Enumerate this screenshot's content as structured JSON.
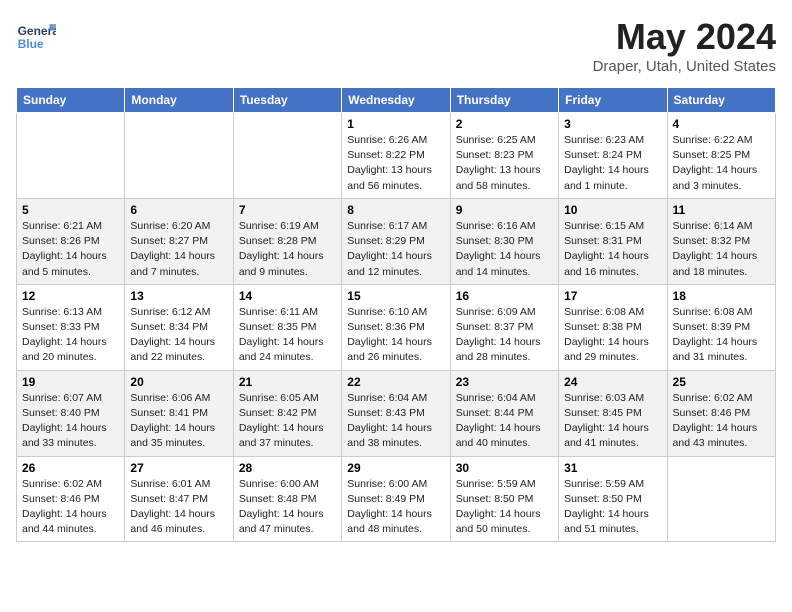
{
  "header": {
    "logo_line1": "General",
    "logo_line2": "Blue",
    "month": "May 2024",
    "location": "Draper, Utah, United States"
  },
  "days_of_week": [
    "Sunday",
    "Monday",
    "Tuesday",
    "Wednesday",
    "Thursday",
    "Friday",
    "Saturday"
  ],
  "weeks": [
    [
      {
        "day": "",
        "sunrise": "",
        "sunset": "",
        "daylight": ""
      },
      {
        "day": "",
        "sunrise": "",
        "sunset": "",
        "daylight": ""
      },
      {
        "day": "",
        "sunrise": "",
        "sunset": "",
        "daylight": ""
      },
      {
        "day": "1",
        "sunrise": "Sunrise: 6:26 AM",
        "sunset": "Sunset: 8:22 PM",
        "daylight": "Daylight: 13 hours and 56 minutes."
      },
      {
        "day": "2",
        "sunrise": "Sunrise: 6:25 AM",
        "sunset": "Sunset: 8:23 PM",
        "daylight": "Daylight: 13 hours and 58 minutes."
      },
      {
        "day": "3",
        "sunrise": "Sunrise: 6:23 AM",
        "sunset": "Sunset: 8:24 PM",
        "daylight": "Daylight: 14 hours and 1 minute."
      },
      {
        "day": "4",
        "sunrise": "Sunrise: 6:22 AM",
        "sunset": "Sunset: 8:25 PM",
        "daylight": "Daylight: 14 hours and 3 minutes."
      }
    ],
    [
      {
        "day": "5",
        "sunrise": "Sunrise: 6:21 AM",
        "sunset": "Sunset: 8:26 PM",
        "daylight": "Daylight: 14 hours and 5 minutes."
      },
      {
        "day": "6",
        "sunrise": "Sunrise: 6:20 AM",
        "sunset": "Sunset: 8:27 PM",
        "daylight": "Daylight: 14 hours and 7 minutes."
      },
      {
        "day": "7",
        "sunrise": "Sunrise: 6:19 AM",
        "sunset": "Sunset: 8:28 PM",
        "daylight": "Daylight: 14 hours and 9 minutes."
      },
      {
        "day": "8",
        "sunrise": "Sunrise: 6:17 AM",
        "sunset": "Sunset: 8:29 PM",
        "daylight": "Daylight: 14 hours and 12 minutes."
      },
      {
        "day": "9",
        "sunrise": "Sunrise: 6:16 AM",
        "sunset": "Sunset: 8:30 PM",
        "daylight": "Daylight: 14 hours and 14 minutes."
      },
      {
        "day": "10",
        "sunrise": "Sunrise: 6:15 AM",
        "sunset": "Sunset: 8:31 PM",
        "daylight": "Daylight: 14 hours and 16 minutes."
      },
      {
        "day": "11",
        "sunrise": "Sunrise: 6:14 AM",
        "sunset": "Sunset: 8:32 PM",
        "daylight": "Daylight: 14 hours and 18 minutes."
      }
    ],
    [
      {
        "day": "12",
        "sunrise": "Sunrise: 6:13 AM",
        "sunset": "Sunset: 8:33 PM",
        "daylight": "Daylight: 14 hours and 20 minutes."
      },
      {
        "day": "13",
        "sunrise": "Sunrise: 6:12 AM",
        "sunset": "Sunset: 8:34 PM",
        "daylight": "Daylight: 14 hours and 22 minutes."
      },
      {
        "day": "14",
        "sunrise": "Sunrise: 6:11 AM",
        "sunset": "Sunset: 8:35 PM",
        "daylight": "Daylight: 14 hours and 24 minutes."
      },
      {
        "day": "15",
        "sunrise": "Sunrise: 6:10 AM",
        "sunset": "Sunset: 8:36 PM",
        "daylight": "Daylight: 14 hours and 26 minutes."
      },
      {
        "day": "16",
        "sunrise": "Sunrise: 6:09 AM",
        "sunset": "Sunset: 8:37 PM",
        "daylight": "Daylight: 14 hours and 28 minutes."
      },
      {
        "day": "17",
        "sunrise": "Sunrise: 6:08 AM",
        "sunset": "Sunset: 8:38 PM",
        "daylight": "Daylight: 14 hours and 29 minutes."
      },
      {
        "day": "18",
        "sunrise": "Sunrise: 6:08 AM",
        "sunset": "Sunset: 8:39 PM",
        "daylight": "Daylight: 14 hours and 31 minutes."
      }
    ],
    [
      {
        "day": "19",
        "sunrise": "Sunrise: 6:07 AM",
        "sunset": "Sunset: 8:40 PM",
        "daylight": "Daylight: 14 hours and 33 minutes."
      },
      {
        "day": "20",
        "sunrise": "Sunrise: 6:06 AM",
        "sunset": "Sunset: 8:41 PM",
        "daylight": "Daylight: 14 hours and 35 minutes."
      },
      {
        "day": "21",
        "sunrise": "Sunrise: 6:05 AM",
        "sunset": "Sunset: 8:42 PM",
        "daylight": "Daylight: 14 hours and 37 minutes."
      },
      {
        "day": "22",
        "sunrise": "Sunrise: 6:04 AM",
        "sunset": "Sunset: 8:43 PM",
        "daylight": "Daylight: 14 hours and 38 minutes."
      },
      {
        "day": "23",
        "sunrise": "Sunrise: 6:04 AM",
        "sunset": "Sunset: 8:44 PM",
        "daylight": "Daylight: 14 hours and 40 minutes."
      },
      {
        "day": "24",
        "sunrise": "Sunrise: 6:03 AM",
        "sunset": "Sunset: 8:45 PM",
        "daylight": "Daylight: 14 hours and 41 minutes."
      },
      {
        "day": "25",
        "sunrise": "Sunrise: 6:02 AM",
        "sunset": "Sunset: 8:46 PM",
        "daylight": "Daylight: 14 hours and 43 minutes."
      }
    ],
    [
      {
        "day": "26",
        "sunrise": "Sunrise: 6:02 AM",
        "sunset": "Sunset: 8:46 PM",
        "daylight": "Daylight: 14 hours and 44 minutes."
      },
      {
        "day": "27",
        "sunrise": "Sunrise: 6:01 AM",
        "sunset": "Sunset: 8:47 PM",
        "daylight": "Daylight: 14 hours and 46 minutes."
      },
      {
        "day": "28",
        "sunrise": "Sunrise: 6:00 AM",
        "sunset": "Sunset: 8:48 PM",
        "daylight": "Daylight: 14 hours and 47 minutes."
      },
      {
        "day": "29",
        "sunrise": "Sunrise: 6:00 AM",
        "sunset": "Sunset: 8:49 PM",
        "daylight": "Daylight: 14 hours and 48 minutes."
      },
      {
        "day": "30",
        "sunrise": "Sunrise: 5:59 AM",
        "sunset": "Sunset: 8:50 PM",
        "daylight": "Daylight: 14 hours and 50 minutes."
      },
      {
        "day": "31",
        "sunrise": "Sunrise: 5:59 AM",
        "sunset": "Sunset: 8:50 PM",
        "daylight": "Daylight: 14 hours and 51 minutes."
      },
      {
        "day": "",
        "sunrise": "",
        "sunset": "",
        "daylight": ""
      }
    ]
  ]
}
